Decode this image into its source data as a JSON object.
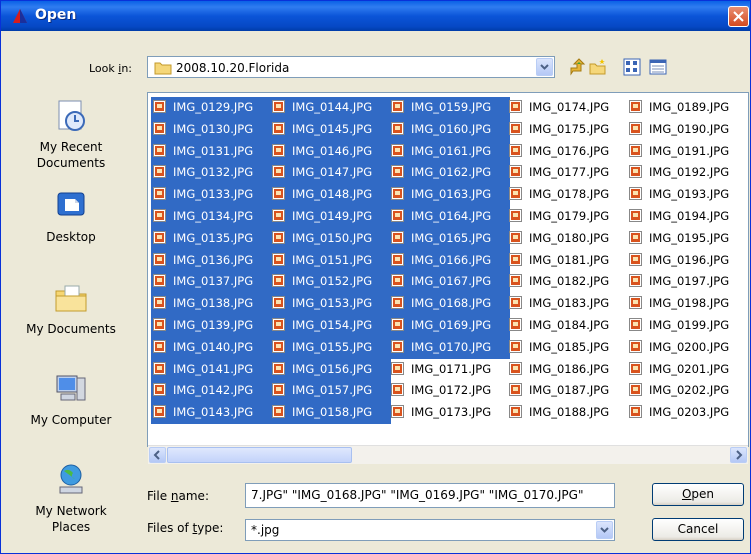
{
  "window": {
    "title": "Open"
  },
  "lookin": {
    "label_pre": "Look ",
    "label_key": "i",
    "label_post": "n:",
    "value": "2008.10.20.Florida"
  },
  "toolbar": {
    "icons": [
      "up-one-level-icon",
      "create-new-folder-icon",
      "view-menu-icon",
      "details-view-icon"
    ]
  },
  "places": [
    {
      "line1": "My Recent",
      "line2": "Documents",
      "icon": "recent-documents-icon"
    },
    {
      "line1": "Desktop",
      "line2": "",
      "icon": "desktop-icon"
    },
    {
      "line1": "My Documents",
      "line2": "",
      "icon": "my-documents-icon"
    },
    {
      "line1": "My Computer",
      "line2": "",
      "icon": "my-computer-icon"
    },
    {
      "line1": "My Network",
      "line2": "Places",
      "icon": "my-network-places-icon"
    }
  ],
  "files": {
    "columns": [
      [
        "IMG_0129.JPG",
        "IMG_0130.JPG",
        "IMG_0131.JPG",
        "IMG_0132.JPG",
        "IMG_0133.JPG",
        "IMG_0134.JPG",
        "IMG_0135.JPG",
        "IMG_0136.JPG",
        "IMG_0137.JPG",
        "IMG_0138.JPG",
        "IMG_0139.JPG",
        "IMG_0140.JPG",
        "IMG_0141.JPG",
        "IMG_0142.JPG",
        "IMG_0143.JPG"
      ],
      [
        "IMG_0144.JPG",
        "IMG_0145.JPG",
        "IMG_0146.JPG",
        "IMG_0147.JPG",
        "IMG_0148.JPG",
        "IMG_0149.JPG",
        "IMG_0150.JPG",
        "IMG_0151.JPG",
        "IMG_0152.JPG",
        "IMG_0153.JPG",
        "IMG_0154.JPG",
        "IMG_0155.JPG",
        "IMG_0156.JPG",
        "IMG_0157.JPG",
        "IMG_0158.JPG"
      ],
      [
        "IMG_0159.JPG",
        "IMG_0160.JPG",
        "IMG_0161.JPG",
        "IMG_0162.JPG",
        "IMG_0163.JPG",
        "IMG_0164.JPG",
        "IMG_0165.JPG",
        "IMG_0166.JPG",
        "IMG_0167.JPG",
        "IMG_0168.JPG",
        "IMG_0169.JPG",
        "IMG_0170.JPG",
        "IMG_0171.JPG",
        "IMG_0172.JPG",
        "IMG_0173.JPG"
      ],
      [
        "IMG_0174.JPG",
        "IMG_0175.JPG",
        "IMG_0176.JPG",
        "IMG_0177.JPG",
        "IMG_0178.JPG",
        "IMG_0179.JPG",
        "IMG_0180.JPG",
        "IMG_0181.JPG",
        "IMG_0182.JPG",
        "IMG_0183.JPG",
        "IMG_0184.JPG",
        "IMG_0185.JPG",
        "IMG_0186.JPG",
        "IMG_0187.JPG",
        "IMG_0188.JPG"
      ],
      [
        "IMG_0189.JPG",
        "IMG_0190.JPG",
        "IMG_0191.JPG",
        "IMG_0192.JPG",
        "IMG_0193.JPG",
        "IMG_0194.JPG",
        "IMG_0195.JPG",
        "IMG_0196.JPG",
        "IMG_0197.JPG",
        "IMG_0198.JPG",
        "IMG_0199.JPG",
        "IMG_0200.JPG",
        "IMG_0201.JPG",
        "IMG_0202.JPG",
        "IMG_0203.JPG"
      ]
    ],
    "selected_first": "IMG_0129.JPG",
    "selected_last": "IMG_0170.JPG"
  },
  "filename": {
    "label_pre": "File ",
    "label_key": "n",
    "label_post": "ame:",
    "value": "7.JPG\" \"IMG_0168.JPG\" \"IMG_0169.JPG\" \"IMG_0170.JPG\""
  },
  "filetype": {
    "label_pre": "Files of ",
    "label_key": "t",
    "label_post": "ype:",
    "value": "*.jpg"
  },
  "buttons": {
    "open_key": "O",
    "open_rest": "pen",
    "cancel": "Cancel"
  },
  "colors": {
    "selection": "#316ac5",
    "titlebar": "#0a55d8",
    "dialog_bg": "#ece9d8"
  }
}
